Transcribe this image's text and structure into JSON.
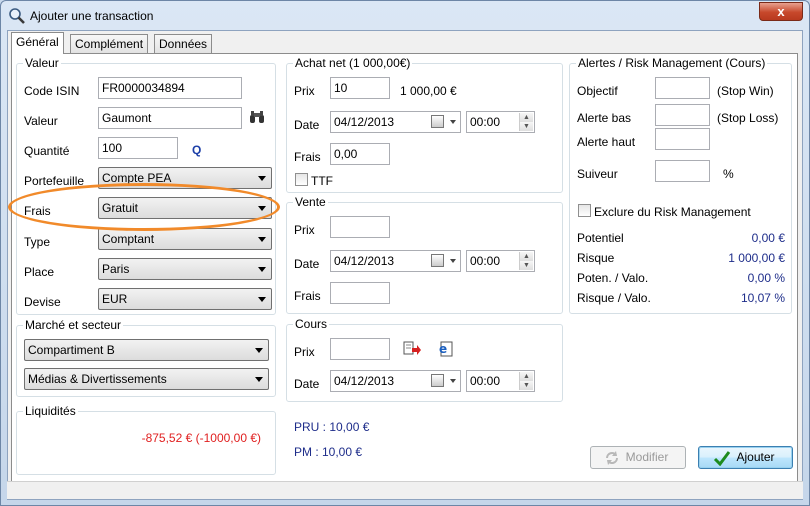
{
  "window": {
    "title": "Ajouter une transaction",
    "close_label": "x"
  },
  "tabs": [
    {
      "label": "Général",
      "active": true
    },
    {
      "label": "Complément",
      "active": false
    },
    {
      "label": "Données",
      "active": false
    }
  ],
  "valeur": {
    "title": "Valeur",
    "code_isin_label": "Code ISIN",
    "code_isin_value": "FR0000034894",
    "valeur_label": "Valeur",
    "valeur_value": "Gaumont",
    "quantite_label": "Quantité",
    "quantite_value": "100",
    "quantite_icon": "Q",
    "portefeuille_label": "Portefeuille",
    "portefeuille_value": "Compte PEA",
    "frais_label": "Frais",
    "frais_value": "Gratuit",
    "type_label": "Type",
    "type_value": "Comptant",
    "place_label": "Place",
    "place_value": "Paris",
    "devise_label": "Devise",
    "devise_value": "EUR"
  },
  "marche": {
    "title": "Marché et secteur",
    "compartiment_value": "Compartiment B",
    "secteur_value": "Médias & Divertissements"
  },
  "liquidites": {
    "title": "Liquidités",
    "value": "-875,52 € (-1000,00 €)"
  },
  "achat": {
    "title": "Achat net (1 000,00€)",
    "prix_label": "Prix",
    "prix_value": "10",
    "prix_total": "1 000,00 €",
    "date_label": "Date",
    "date_value": "04/12/2013",
    "time_value": "00:00",
    "frais_label": "Frais",
    "frais_value": "0,00",
    "ttf_label": "TTF"
  },
  "vente": {
    "title": "Vente",
    "prix_label": "Prix",
    "prix_value": "",
    "date_label": "Date",
    "date_value": "04/12/2013",
    "time_value": "00:00",
    "frais_label": "Frais",
    "frais_value": ""
  },
  "cours": {
    "title": "Cours",
    "prix_label": "Prix",
    "prix_value": "",
    "date_label": "Date",
    "date_value": "04/12/2013",
    "time_value": "00:00"
  },
  "pru": {
    "pru_text": "PRU : 10,00 €",
    "pm_text": "PM : 10,00 €"
  },
  "alertes": {
    "title": "Alertes / Risk Management (Cours)",
    "objectif_label": "Objectif",
    "objectif_note": "(Stop Win)",
    "alerte_bas_label": "Alerte bas",
    "alerte_bas_note": "(Stop Loss)",
    "alerte_haut_label": "Alerte haut",
    "suiveur_label": "Suiveur",
    "suiveur_unit": "%",
    "exclure_label": "Exclure du Risk Management",
    "stats": [
      {
        "label": "Potentiel",
        "value": "0,00 €"
      },
      {
        "label": "Risque",
        "value": "1 000,00 €"
      },
      {
        "label": "Poten. / Valo.",
        "value": "0,00 %"
      },
      {
        "label": "Risque / Valo.",
        "value": "10,07 %"
      }
    ]
  },
  "buttons": {
    "modifier_label": "Modifier",
    "ajouter_label": "Ajouter"
  },
  "colors": {
    "highlight": "#f18a2a",
    "negative": "#e02020",
    "stat_value": "#1e2d8a"
  }
}
